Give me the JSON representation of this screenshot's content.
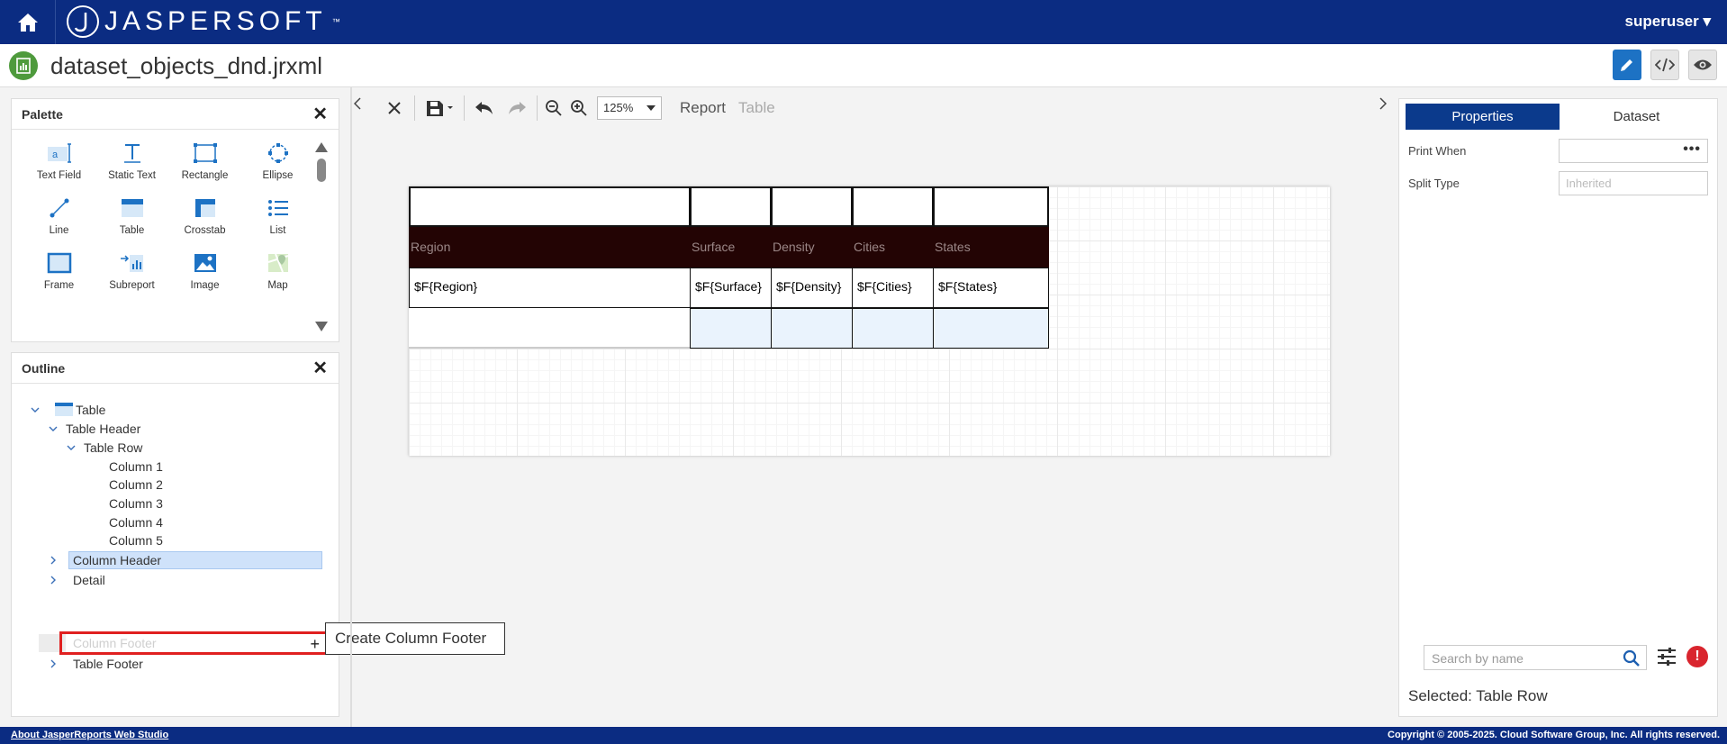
{
  "header": {
    "brand": "JASPERSOFT",
    "trademark": "™",
    "user": "superuser ▾"
  },
  "titlebar": {
    "file_name": "dataset_objects_dnd.jrxml"
  },
  "palette": {
    "title": "Palette",
    "items": [
      {
        "label": "Text Field",
        "icon": "text-field-icon"
      },
      {
        "label": "Static Text",
        "icon": "static-text-icon"
      },
      {
        "label": "Rectangle",
        "icon": "rectangle-icon"
      },
      {
        "label": "Ellipse",
        "icon": "ellipse-icon"
      },
      {
        "label": "Line",
        "icon": "line-icon"
      },
      {
        "label": "Table",
        "icon": "table-icon"
      },
      {
        "label": "Crosstab",
        "icon": "crosstab-icon"
      },
      {
        "label": "List",
        "icon": "list-icon"
      },
      {
        "label": "Frame",
        "icon": "frame-icon"
      },
      {
        "label": "Subreport",
        "icon": "subreport-icon"
      },
      {
        "label": "Image",
        "icon": "image-icon"
      },
      {
        "label": "Map",
        "icon": "map-icon"
      }
    ]
  },
  "outline": {
    "title": "Outline",
    "nodes": {
      "table": "Table",
      "table_header": "Table Header",
      "table_row": "Table Row",
      "col1": "Column 1",
      "col2": "Column 2",
      "col3": "Column 3",
      "col4": "Column 4",
      "col5": "Column 5",
      "column_header": "Column Header",
      "detail": "Detail",
      "column_footer": "Column Footer",
      "table_footer": "Table Footer"
    },
    "tooltip": "Create Column Footer"
  },
  "toolbar": {
    "zoom": "125%",
    "crumb_report": "Report",
    "crumb_table": "Table"
  },
  "report_table": {
    "headers": [
      "Region",
      "Surface",
      "Density",
      "Cities",
      "States"
    ],
    "fields": [
      "$F{Region}",
      "$F{Surface}",
      "$F{Density}",
      "$F{Cities}",
      "$F{States}"
    ]
  },
  "right_panel": {
    "tab_properties": "Properties",
    "tab_dataset": "Dataset",
    "print_when_label": "Print When",
    "split_type_label": "Split Type",
    "split_type_placeholder": "Inherited",
    "search_placeholder": "Search by name",
    "error_badge": "!",
    "selected": "Selected: Table Row"
  },
  "footer": {
    "about": "About JasperReports Web Studio",
    "copyright": "Copyright © 2005-2025. Cloud Software Group, Inc. All rights reserved."
  },
  "colors": {
    "header_bg": "#0b2c82",
    "accent": "#1d72c4",
    "table_header_bg": "#230404",
    "error": "#d9252e"
  }
}
